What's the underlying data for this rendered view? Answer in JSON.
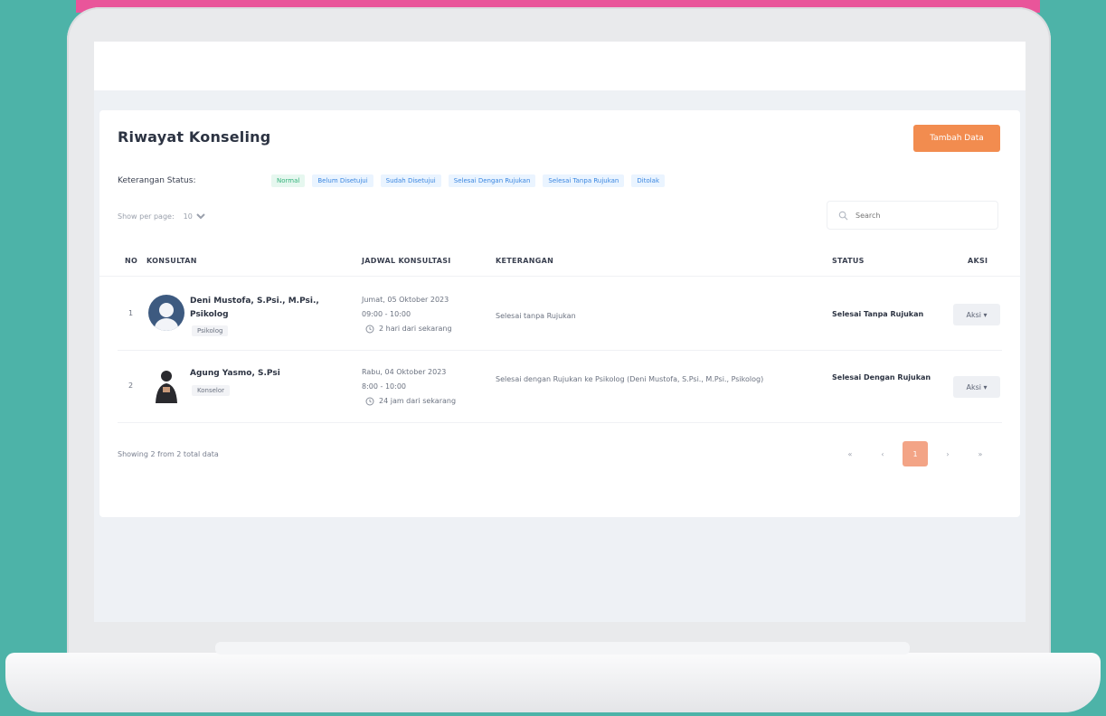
{
  "page": {
    "title": "Riwayat Konseling",
    "add_button": "Tambah Data"
  },
  "status_legend": {
    "label": "Keterangan Status:",
    "chips": [
      "Normal",
      "Belum Disetujui",
      "Sudah Disetujui",
      "Selesai Dengan Rujukan",
      "Selesai Tanpa Rujukan",
      "Ditolak"
    ]
  },
  "controls": {
    "show_per_page_label": "Show per page:",
    "per_page_value": "10",
    "search_placeholder": "Search"
  },
  "table": {
    "headers": [
      "NO",
      "KONSULTAN",
      "JADWAL KONSULTASI",
      "KETERANGAN",
      "STATUS",
      "AKSI"
    ],
    "rows": [
      {
        "no": "1",
        "name": "Deni Mustofa, S.Psi., M.Psi., Psikolog",
        "role": "Psikolog",
        "date": "Jumat, 05 Oktober 2023",
        "time": "09:00 - 10:00",
        "relative": "2 hari dari sekarang",
        "keterangan": "Selesai tanpa Rujukan",
        "status": "Selesai Tanpa Rujukan",
        "action": "Aksi"
      },
      {
        "no": "2",
        "name": "Agung Yasmo, S.Psi",
        "role": "Konselor",
        "date": "Rabu, 04 Oktober 2023",
        "time": "8:00 - 10:00",
        "relative": "24 jam dari sekarang",
        "keterangan": "Selesai dengan Rujukan ke Psikolog (Deni Mustofa, S.Psi., M.Psi., Psikolog)",
        "status": "Selesai Dengan Rujukan",
        "action": "Aksi"
      }
    ]
  },
  "footer": {
    "showing": "Showing 2 from 2 total data",
    "pages": [
      "«",
      "‹",
      "1",
      "›",
      "»"
    ],
    "active_page": "1"
  },
  "colors": {
    "background": "#4db3a8",
    "accent": "#f28c4f",
    "laptop_top_strip": "#e9559a"
  }
}
